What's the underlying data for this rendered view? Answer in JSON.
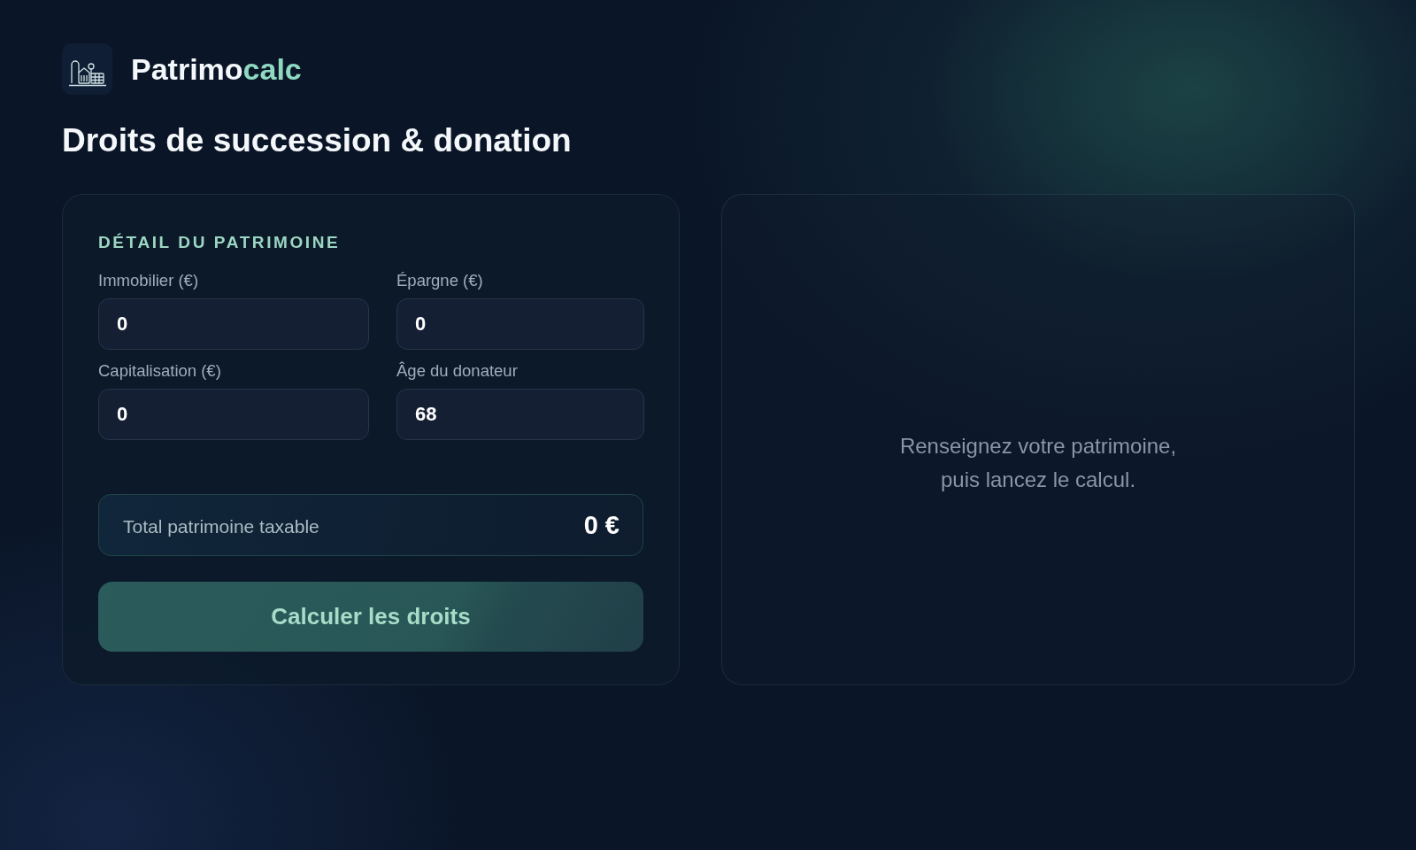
{
  "brand": {
    "name": "Patrimo",
    "accent": "calc"
  },
  "page_title": "Droits de succession & donation",
  "form": {
    "section_title": "DÉTAIL DU PATRIMOINE",
    "fields": [
      {
        "label": "Immobilier (€)",
        "value": "0"
      },
      {
        "label": "Épargne (€)",
        "value": "0"
      },
      {
        "label": "Capitalisation (€)",
        "value": "0"
      },
      {
        "label": "Âge du donateur",
        "value": "68"
      }
    ],
    "total": {
      "label": "Total patrimoine taxable",
      "value": "0 €"
    },
    "button": "Calculer les droits"
  },
  "result_panel": {
    "message": "Renseignez votre patrimoine, puis lancez le calcul."
  }
}
